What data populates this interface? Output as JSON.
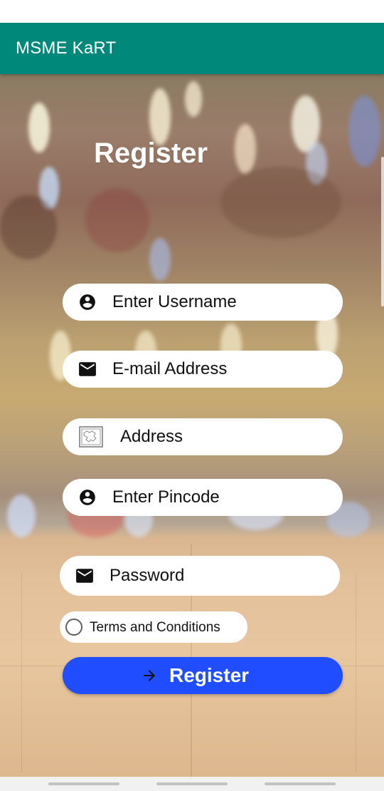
{
  "app_bar": {
    "title": "MSME KaRT",
    "color": "#00897B"
  },
  "form": {
    "title": "Register",
    "fields": {
      "username": {
        "placeholder": "Enter Username",
        "icon": "account-circle-icon"
      },
      "email": {
        "placeholder": "E-mail Address",
        "icon": "email-icon"
      },
      "address": {
        "placeholder": "Address",
        "icon": "map-icon"
      },
      "pincode": {
        "placeholder": "Enter Pincode",
        "icon": "account-circle-icon"
      },
      "password": {
        "placeholder": "Password",
        "icon": "email-icon"
      }
    },
    "terms_label": "Terms and Conditions",
    "register_button": {
      "label": "Register",
      "icon": "arrow-right-icon",
      "color": "#1F4DFF"
    }
  }
}
